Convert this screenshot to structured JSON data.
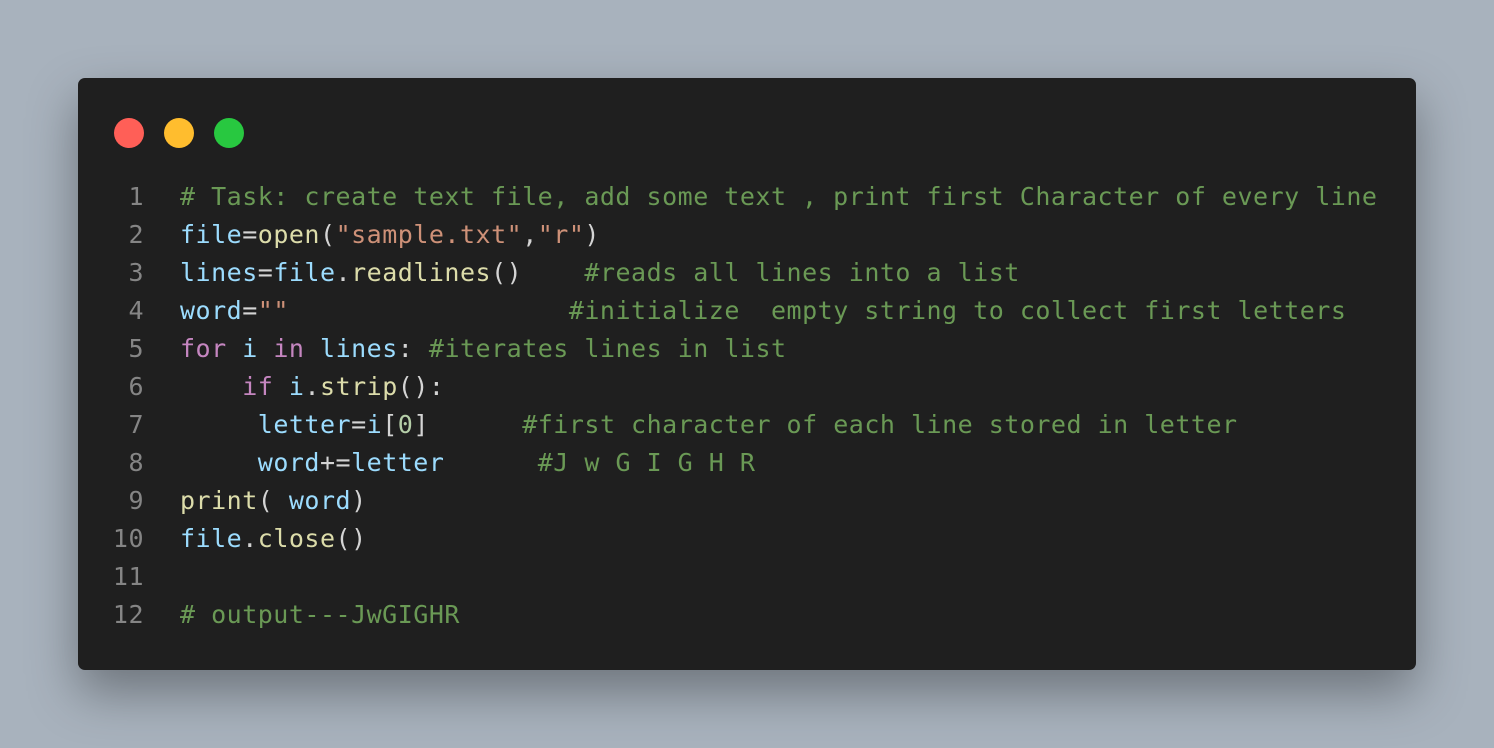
{
  "colors": {
    "background": "#a8b2bd",
    "editor_bg": "#1f1f1f",
    "dot_close": "#ff5f57",
    "dot_minimize": "#ffbd2e",
    "dot_maximize": "#28c840",
    "comment": "#6a9955",
    "variable": "#9cdcfe",
    "function": "#dcdcaa",
    "string": "#ce9178",
    "keyword": "#c586c0",
    "punctuation": "#d4d4d4",
    "line_number": "#858585"
  },
  "window_controls": [
    "close-dot",
    "minimize-dot",
    "maximize-dot"
  ],
  "code": {
    "lines": [
      {
        "number": "1",
        "tokens": [
          {
            "t": "c",
            "text": "# Task: create text file, add some text , print first Character of every line"
          }
        ]
      },
      {
        "number": "2",
        "tokens": [
          {
            "t": "v",
            "text": "file"
          },
          {
            "t": "p",
            "text": "="
          },
          {
            "t": "f",
            "text": "open"
          },
          {
            "t": "p",
            "text": "("
          },
          {
            "t": "s",
            "text": "\"sample.txt\""
          },
          {
            "t": "p",
            "text": ","
          },
          {
            "t": "s",
            "text": "\"r\""
          },
          {
            "t": "p",
            "text": ")"
          }
        ]
      },
      {
        "number": "3",
        "tokens": [
          {
            "t": "v",
            "text": "lines"
          },
          {
            "t": "p",
            "text": "="
          },
          {
            "t": "v",
            "text": "file"
          },
          {
            "t": "p",
            "text": "."
          },
          {
            "t": "f",
            "text": "readlines"
          },
          {
            "t": "p",
            "text": "()    "
          },
          {
            "t": "c",
            "text": "#reads all lines into a list"
          }
        ]
      },
      {
        "number": "4",
        "tokens": [
          {
            "t": "v",
            "text": "word"
          },
          {
            "t": "p",
            "text": "="
          },
          {
            "t": "s",
            "text": "\"\""
          },
          {
            "t": "p",
            "text": "                  "
          },
          {
            "t": "c",
            "text": "#initialize  empty string to collect first letters"
          }
        ]
      },
      {
        "number": "5",
        "tokens": [
          {
            "t": "k",
            "text": "for"
          },
          {
            "t": "p",
            "text": " "
          },
          {
            "t": "v",
            "text": "i"
          },
          {
            "t": "p",
            "text": " "
          },
          {
            "t": "k",
            "text": "in"
          },
          {
            "t": "p",
            "text": " "
          },
          {
            "t": "v",
            "text": "lines"
          },
          {
            "t": "p",
            "text": ": "
          },
          {
            "t": "c",
            "text": "#iterates lines in list"
          }
        ]
      },
      {
        "number": "6",
        "tokens": [
          {
            "t": "p",
            "text": "    "
          },
          {
            "t": "k",
            "text": "if"
          },
          {
            "t": "p",
            "text": " "
          },
          {
            "t": "v",
            "text": "i"
          },
          {
            "t": "p",
            "text": "."
          },
          {
            "t": "f",
            "text": "strip"
          },
          {
            "t": "p",
            "text": "():"
          }
        ]
      },
      {
        "number": "7",
        "tokens": [
          {
            "t": "p",
            "text": "     "
          },
          {
            "t": "v",
            "text": "letter"
          },
          {
            "t": "p",
            "text": "="
          },
          {
            "t": "v",
            "text": "i"
          },
          {
            "t": "p",
            "text": "["
          },
          {
            "t": "n",
            "text": "0"
          },
          {
            "t": "p",
            "text": "]      "
          },
          {
            "t": "c",
            "text": "#first character of each line stored in letter"
          }
        ]
      },
      {
        "number": "8",
        "tokens": [
          {
            "t": "p",
            "text": "     "
          },
          {
            "t": "v",
            "text": "word"
          },
          {
            "t": "p",
            "text": "+="
          },
          {
            "t": "v",
            "text": "letter"
          },
          {
            "t": "p",
            "text": "      "
          },
          {
            "t": "c",
            "text": "#J w G I G H R"
          }
        ]
      },
      {
        "number": "9",
        "tokens": [
          {
            "t": "f",
            "text": "print"
          },
          {
            "t": "p",
            "text": "( "
          },
          {
            "t": "v",
            "text": "word"
          },
          {
            "t": "p",
            "text": ")"
          }
        ]
      },
      {
        "number": "10",
        "tokens": [
          {
            "t": "v",
            "text": "file"
          },
          {
            "t": "p",
            "text": "."
          },
          {
            "t": "f",
            "text": "close"
          },
          {
            "t": "p",
            "text": "()"
          }
        ]
      },
      {
        "number": "11",
        "tokens": []
      },
      {
        "number": "12",
        "tokens": [
          {
            "t": "c",
            "text": "# output---JwGIGHR"
          }
        ]
      }
    ]
  }
}
